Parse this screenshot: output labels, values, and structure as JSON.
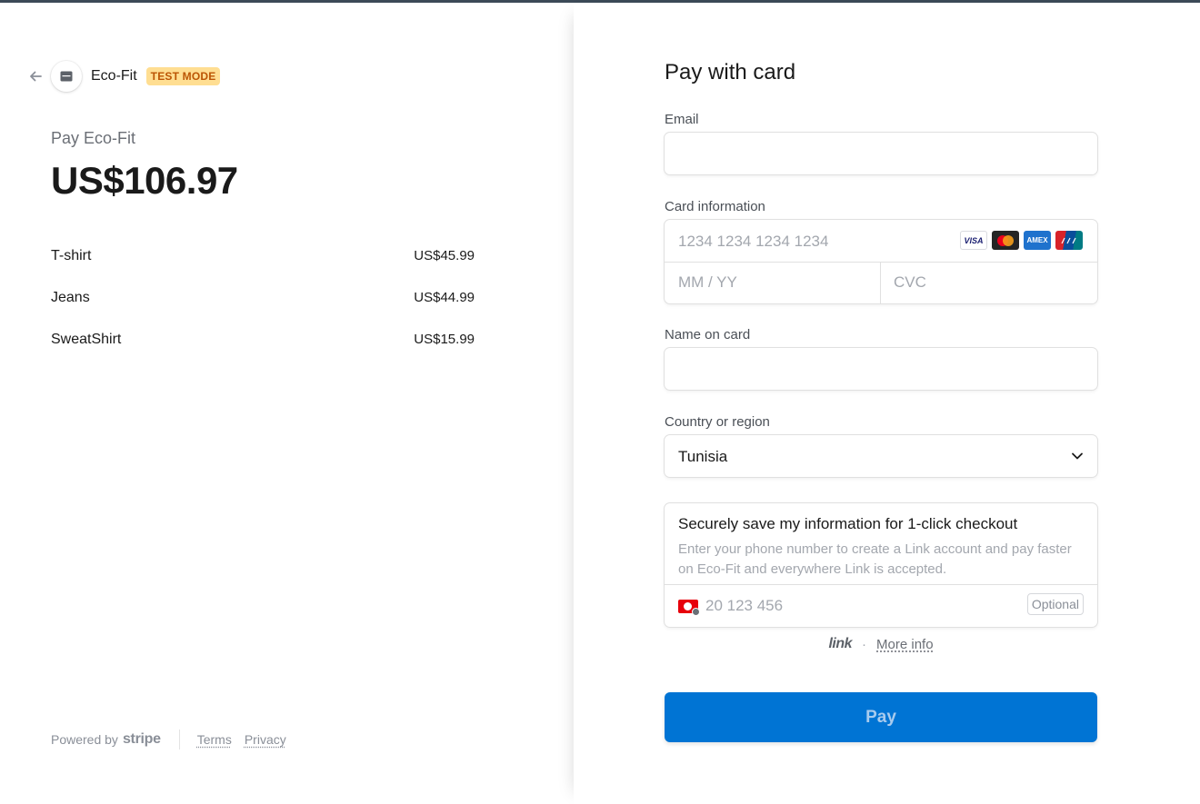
{
  "header": {
    "merchant": "Eco-Fit",
    "badge": "TEST MODE"
  },
  "summary": {
    "pay_label": "Pay Eco-Fit",
    "amount": "US$106.97",
    "items": [
      {
        "name": "T-shirt",
        "price": "US$45.99"
      },
      {
        "name": "Jeans",
        "price": "US$44.99"
      },
      {
        "name": "SweatShirt",
        "price": "US$15.99"
      }
    ]
  },
  "footer": {
    "powered_by": "Powered by",
    "brand": "stripe",
    "terms": "Terms",
    "privacy": "Privacy"
  },
  "form": {
    "title": "Pay with card",
    "email_label": "Email",
    "email_value": "",
    "card_label": "Card information",
    "card_number_placeholder": "1234 1234 1234 1234",
    "expiry_placeholder": "MM / YY",
    "cvc_placeholder": "CVC",
    "card_brands": [
      "VISA",
      "Mastercard",
      "AMEX",
      "UnionPay"
    ],
    "name_label": "Name on card",
    "name_value": "",
    "country_label": "Country or region",
    "country_value": "Tunisia",
    "link": {
      "title": "Securely save my information for 1-click checkout",
      "description": "Enter your phone number to create a Link account and pay faster on Eco-Fit and everywhere Link is accepted.",
      "phone_placeholder": "20 123 456",
      "optional": "Optional",
      "logo": "link",
      "separator": "·",
      "more_info": "More info"
    },
    "pay_button": "Pay"
  },
  "colors": {
    "accent": "#0074d4",
    "badge_bg": "#ffde92",
    "badge_text": "#bb5504"
  }
}
